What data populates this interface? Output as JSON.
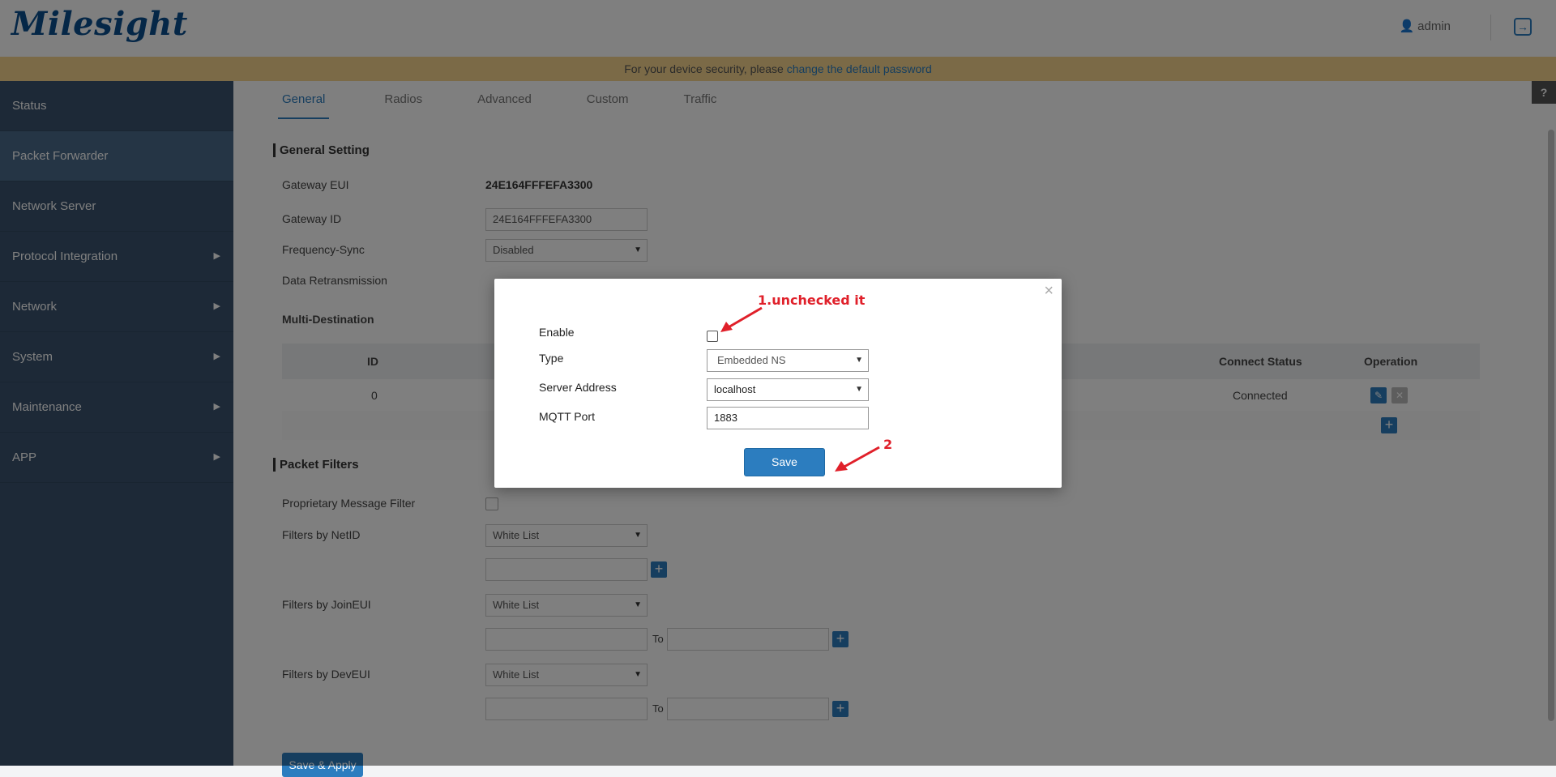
{
  "header": {
    "logo": "Milesight",
    "user": "admin"
  },
  "notice": {
    "text": "For your device security, please ",
    "link": "change the default password"
  },
  "sidebar": {
    "items": [
      {
        "label": "Status",
        "arrow": false
      },
      {
        "label": "Packet Forwarder",
        "arrow": false,
        "active": true
      },
      {
        "label": "Network Server",
        "arrow": false
      },
      {
        "label": "Protocol Integration",
        "arrow": true
      },
      {
        "label": "Network",
        "arrow": true
      },
      {
        "label": "System",
        "arrow": true
      },
      {
        "label": "Maintenance",
        "arrow": true
      },
      {
        "label": "APP",
        "arrow": true
      }
    ]
  },
  "tabs": [
    "General",
    "Radios",
    "Advanced",
    "Custom",
    "Traffic"
  ],
  "general": {
    "title": "General Setting",
    "gateway_eui_label": "Gateway EUI",
    "gateway_eui": "24E164FFFEFA3300",
    "gateway_id_label": "Gateway ID",
    "gateway_id": "24E164FFFEFA3300",
    "frequency_sync_label": "Frequency-Sync",
    "frequency_sync": "Disabled",
    "data_retransmission_label": "Data Retransmission",
    "multi_destination_label": "Multi-Destination"
  },
  "table": {
    "headers": {
      "id": "ID",
      "connect_status": "Connect Status",
      "operation": "Operation"
    },
    "row": {
      "id": "0",
      "connect_status": "Connected"
    }
  },
  "filters": {
    "title": "Packet Filters",
    "proprietary_label": "Proprietary Message Filter",
    "netid_label": "Filters by NetID",
    "netid_mode": "White List",
    "joineui_label": "Filters by JoinEUI",
    "joineui_mode": "White List",
    "deveui_label": "Filters by DevEUI",
    "deveui_mode": "White List",
    "to_label": "To"
  },
  "save_apply": "Save & Apply",
  "help": "?",
  "modal": {
    "close": "×",
    "enable_label": "Enable",
    "type_label": "Type",
    "type_value": "Embedded NS",
    "server_label": "Server Address",
    "server_value": "localhost",
    "port_label": "MQTT Port",
    "port_value": "1883",
    "save": "Save"
  },
  "annotations": {
    "step1": "1.unchecked it",
    "step2": "2",
    "color": "#e0202a"
  }
}
